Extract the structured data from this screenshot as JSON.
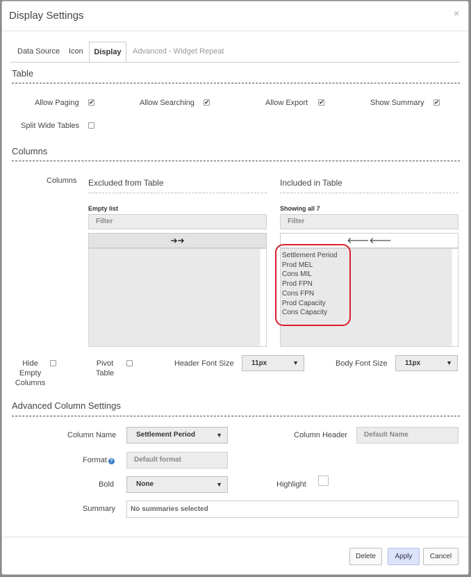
{
  "dialog": {
    "title": "Display Settings",
    "close": "×"
  },
  "tabs": [
    {
      "label": "Data Source"
    },
    {
      "label": "Icon"
    },
    {
      "label": "Display"
    },
    {
      "label": "Advanced - Widget Repeat"
    }
  ],
  "table_section": {
    "title": "Table",
    "options": [
      {
        "label": "Allow Paging",
        "checked": true
      },
      {
        "label": "Allow Searching",
        "checked": true
      },
      {
        "label": "Allow Export",
        "checked": true
      },
      {
        "label": "Show Summary",
        "checked": true
      },
      {
        "label": "Split Wide Tables",
        "checked": false
      }
    ],
    "check_glyph": "✔"
  },
  "columns_section": {
    "title": "Columns",
    "label": "Columns",
    "excluded": {
      "title": "Excluded from Table",
      "status": "Empty list",
      "filter_placeholder": "Filter",
      "move_glyph": "➔➔"
    },
    "included": {
      "title": "Included in Table",
      "status": "Showing all 7",
      "filter_placeholder": "Filter",
      "move_glyph": "🡐🡐",
      "items": [
        "Settlement Period",
        "Prod MEL",
        "Cons MIL",
        "Prod FPN",
        "Cons FPN",
        "Prod Capacity",
        "Cons Capacity"
      ]
    },
    "hide_empty": {
      "line1": "Hide",
      "line2": "Empty",
      "line3": "Columns"
    },
    "pivot": {
      "line1": "Pivot",
      "line2": "Table"
    },
    "header_font_size": {
      "label": "Header Font Size",
      "value": "11px"
    },
    "body_font_size": {
      "label": "Body Font Size",
      "value": "11px"
    }
  },
  "advanced": {
    "title": "Advanced Column Settings",
    "column_name": {
      "label": "Column Name",
      "value": "Settlement Period"
    },
    "column_header": {
      "label": "Column Header",
      "placeholder": "Default Name"
    },
    "format": {
      "label": "Format",
      "placeholder": "Default format",
      "help": "?"
    },
    "bold": {
      "label": "Bold",
      "value": "None"
    },
    "highlight": {
      "label": "Highlight"
    },
    "summary": {
      "label": "Summary",
      "value": "No summaries selected"
    }
  },
  "caret": "▼",
  "footer": {
    "delete": "Delete",
    "apply": "Apply",
    "cancel": "Cancel"
  }
}
